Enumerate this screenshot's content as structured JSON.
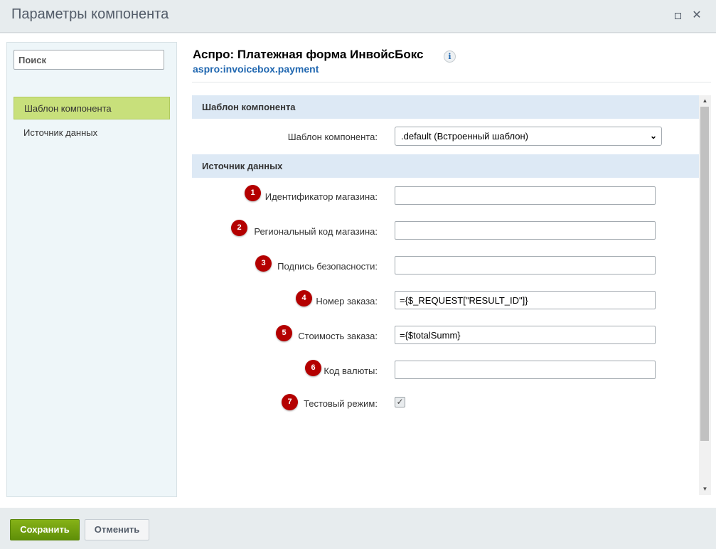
{
  "window": {
    "title": "Параметры компонента"
  },
  "sidebar": {
    "search_placeholder": "Поиск",
    "items": [
      {
        "label": "Шаблон компонента",
        "active": true
      },
      {
        "label": "Источник данных",
        "active": false
      }
    ]
  },
  "component": {
    "title": "Аспро: Платежная форма ИнвойсБокс",
    "code": "aspro:invoicebox.payment",
    "info_icon_glyph": "i"
  },
  "sections": [
    {
      "header": "Шаблон компонента",
      "fields": [
        {
          "label": "Шаблон компонента:",
          "type": "select",
          "value": ".default (Встроенный шаблон)"
        }
      ]
    },
    {
      "header": "Источник данных",
      "fields": [
        {
          "badge": "1",
          "label": "Идентификатор магазина:",
          "type": "text",
          "value": ""
        },
        {
          "badge": "2",
          "label": "Региональный код магазина:",
          "type": "text",
          "value": ""
        },
        {
          "badge": "3",
          "label": "Подпись безопасности:",
          "type": "text",
          "value": ""
        },
        {
          "badge": "4",
          "label": "Номер заказа:",
          "type": "text",
          "value": "={$_REQUEST[\"RESULT_ID\"]}"
        },
        {
          "badge": "5",
          "label": "Стоимость заказа:",
          "type": "text",
          "value": "={$totalSumm}"
        },
        {
          "badge": "6",
          "label": "Код валюты:",
          "type": "text",
          "value": ""
        },
        {
          "badge": "7",
          "label": "Тестовый режим:",
          "type": "checkbox",
          "checked": true
        }
      ]
    }
  ],
  "footer": {
    "save_label": "Сохранить",
    "cancel_label": "Отменить"
  },
  "colors": {
    "accent_green": "#6d9c0f",
    "section_header_bg": "#dde9f5",
    "badge_red": "#b40000",
    "link_blue": "#2067b0"
  }
}
